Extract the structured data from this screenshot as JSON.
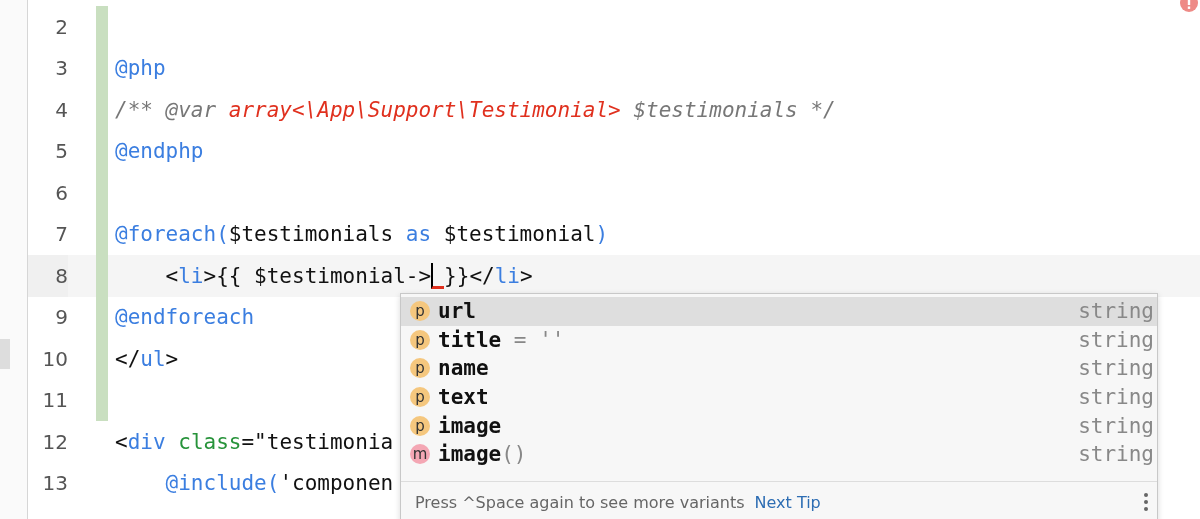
{
  "editor": {
    "lines": [
      {
        "number": "2",
        "changed": true,
        "current": false
      },
      {
        "number": "3",
        "changed": true,
        "current": false,
        "segments": [
          {
            "kind": "blade",
            "text": "@php"
          }
        ]
      },
      {
        "number": "4",
        "changed": true,
        "current": false,
        "segments": [
          {
            "kind": "comment",
            "text": "/** @var "
          },
          {
            "kind": "doctype",
            "text": "array<\\App\\Support\\Testimonial>"
          },
          {
            "kind": "comment",
            "text": " $testimonials */"
          }
        ]
      },
      {
        "number": "5",
        "changed": true,
        "current": false,
        "segments": [
          {
            "kind": "blade",
            "text": "@endphp"
          }
        ]
      },
      {
        "number": "6",
        "changed": true,
        "current": false
      },
      {
        "number": "7",
        "changed": true,
        "current": false,
        "segments": [
          {
            "kind": "blade",
            "text": "@foreach("
          },
          {
            "kind": "plain",
            "text": "$testimonials "
          },
          {
            "kind": "blade",
            "text": "as"
          },
          {
            "kind": "plain",
            "text": " $testimonial"
          },
          {
            "kind": "blade",
            "text": ")"
          }
        ]
      },
      {
        "number": "8",
        "changed": true,
        "current": true,
        "segments": [
          {
            "kind": "plain",
            "text": "    <"
          },
          {
            "kind": "tag",
            "text": "li"
          },
          {
            "kind": "plain",
            "text": ">{{ $testimonial->"
          },
          {
            "kind": "caret"
          },
          {
            "kind": "plain",
            "text": "}}</"
          },
          {
            "kind": "tag",
            "text": "li"
          },
          {
            "kind": "plain",
            "text": ">"
          }
        ]
      },
      {
        "number": "9",
        "changed": true,
        "current": false,
        "segments": [
          {
            "kind": "blade",
            "text": "@endforeach"
          }
        ]
      },
      {
        "number": "10",
        "changed": true,
        "current": false,
        "segments": [
          {
            "kind": "plain",
            "text": "</"
          },
          {
            "kind": "tag",
            "text": "ul"
          },
          {
            "kind": "plain",
            "text": ">"
          }
        ]
      },
      {
        "number": "11",
        "changed": true,
        "current": false
      },
      {
        "number": "12",
        "changed": false,
        "current": false,
        "segments": [
          {
            "kind": "plain",
            "text": "<"
          },
          {
            "kind": "tag",
            "text": "div"
          },
          {
            "kind": "attr",
            "text": " class"
          },
          {
            "kind": "plain",
            "text": "=\"testimonia"
          }
        ]
      },
      {
        "number": "13",
        "changed": false,
        "current": false,
        "segments": [
          {
            "kind": "blade",
            "text": "    @include("
          },
          {
            "kind": "plain",
            "text": "'componen"
          }
        ]
      }
    ]
  },
  "completion": {
    "items": [
      {
        "kind": "property",
        "badge": "p",
        "name": "url",
        "type": "string",
        "selected": true
      },
      {
        "kind": "property",
        "badge": "p",
        "name": "title",
        "suffix": " = ''",
        "type": "string",
        "selected": false
      },
      {
        "kind": "property",
        "badge": "p",
        "name": "name",
        "type": "string",
        "selected": false
      },
      {
        "kind": "property",
        "badge": "p",
        "name": "text",
        "type": "string",
        "selected": false
      },
      {
        "kind": "property",
        "badge": "p",
        "name": "image",
        "type": "string",
        "selected": false
      },
      {
        "kind": "method",
        "badge": "m",
        "name": "image",
        "suffix": "()",
        "type": "string",
        "selected": false
      }
    ],
    "hint": "Press ^Space again to see more variants",
    "link": "Next Tip"
  }
}
